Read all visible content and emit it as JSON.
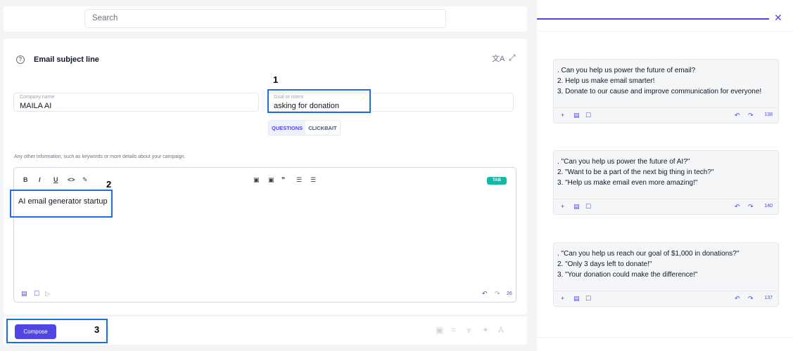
{
  "search": {
    "placeholder": "Search"
  },
  "form": {
    "title": "Email subject line",
    "company": {
      "label": "Company name",
      "value": "MAILA AI"
    },
    "goal": {
      "label": "Goal or intent",
      "value": "asking for donation"
    },
    "tabs": [
      {
        "label": "QUESTIONS",
        "active": true
      },
      {
        "label": "CLICKBAIT",
        "active": false
      }
    ],
    "hint": "Any other information, such as keywords or more details about your campaign.",
    "editor": {
      "content": "AI email generator startup",
      "tab_badge": "TAB",
      "count": "26"
    },
    "compose_label": "Compose"
  },
  "annotations": [
    "1",
    "2",
    "3"
  ],
  "results": [
    {
      "lines": [
        ". Can you help us power the future of email?",
        "2. Help us make email smarter!",
        "3. Donate to our cause and improve communication for everyone!"
      ],
      "count": "138"
    },
    {
      "lines": [
        ". \"Can you help us power the future of AI?\"",
        "2. \"Want to be a part of the next big thing in tech?\"",
        "3. \"Help us make email even more amazing!\""
      ],
      "count": "140"
    },
    {
      "lines": [
        ". \"Can you help us reach our goal of $1,000 in donations?\"",
        "2. \"Only 3 days left to donate!\"",
        "3. \"Your donation could make the difference!\""
      ],
      "count": "137"
    }
  ],
  "colors": {
    "accent": "#4f46e5",
    "annotation": "#1e6fd9",
    "badge": "#14b8a6"
  }
}
